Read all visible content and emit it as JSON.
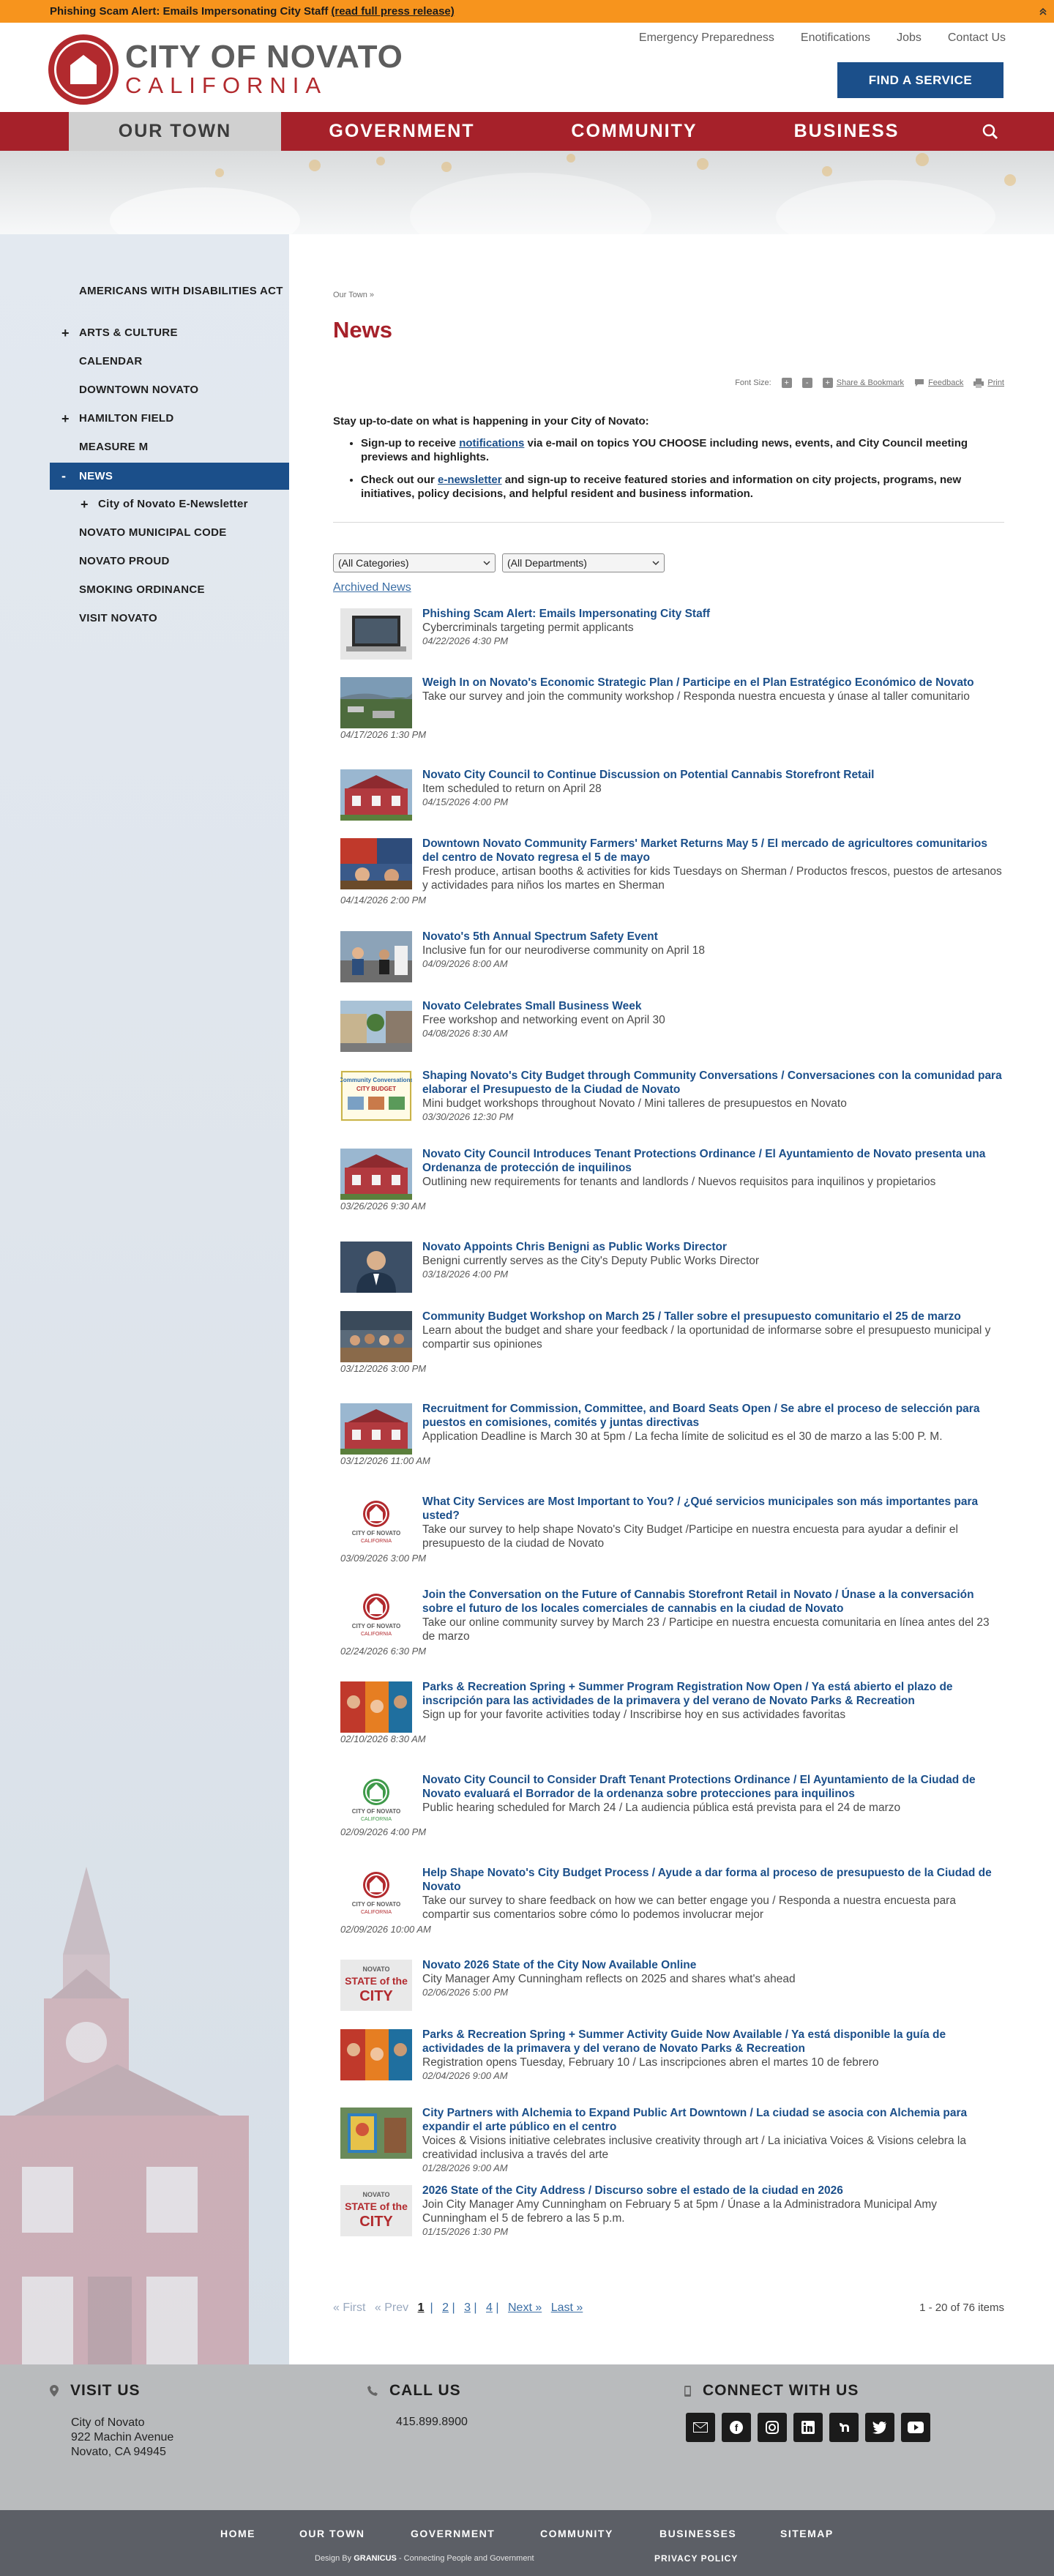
{
  "alert": {
    "text": "Phishing Scam Alert: Emails Impersonating City Staff",
    "link": "(read full press release)"
  },
  "header": {
    "logo_line1": "CITY OF NOVATO",
    "logo_line2": "CALIFORNIA",
    "utility_links": [
      "Emergency Preparedness",
      "Enotifications",
      "Jobs",
      "Contact Us"
    ],
    "find_service": "FIND A SERVICE"
  },
  "nav": {
    "items": [
      "OUR TOWN",
      "GOVERNMENT",
      "COMMUNITY",
      "BUSINESS"
    ],
    "active": "OUR TOWN"
  },
  "sidebar": {
    "items": [
      {
        "label": "AMERICANS WITH DISABILITIES ACT",
        "expand": ""
      },
      {
        "label": "ARTS & CULTURE",
        "expand": "+"
      },
      {
        "label": "CALENDAR",
        "expand": ""
      },
      {
        "label": "DOWNTOWN NOVATO",
        "expand": ""
      },
      {
        "label": "HAMILTON FIELD",
        "expand": "+"
      },
      {
        "label": "MEASURE M",
        "expand": ""
      },
      {
        "label": "NEWS",
        "expand": "-"
      },
      {
        "label": "City of Novato E-Newsletter",
        "expand": "+"
      },
      {
        "label": "NOVATO MUNICIPAL CODE",
        "expand": ""
      },
      {
        "label": "NOVATO PROUD",
        "expand": ""
      },
      {
        "label": "SMOKING ORDINANCE",
        "expand": ""
      },
      {
        "label": "VISIT NOVATO",
        "expand": ""
      }
    ]
  },
  "page": {
    "breadcrumb": "Our Town »",
    "title": "News",
    "tools": {
      "font_size": "Font Size:",
      "font_plus": "+",
      "font_minus": "-",
      "share": "Share & Bookmark",
      "feedback": "Feedback",
      "print": "Print"
    },
    "intro": "Stay up-to-date on what is happening in your City of Novato:",
    "bullet1_pre": "Sign-up to receive ",
    "bullet1_link": "notifications",
    "bullet1_post": " via e-mail on topics YOU CHOOSE including news, events, and City Council meeting previews and highlights.",
    "bullet2_pre": "Check out our ",
    "bullet2_link": "e-newsletter",
    "bullet2_post": " and sign-up to receive featured stories and information on city projects, programs, new initiatives, policy decisions, and helpful resident and business information.",
    "filter_categories": "(All Categories)",
    "filter_departments": "(All Departments)",
    "archived": "Archived News"
  },
  "news": [
    {
      "title": "Phishing Scam Alert: Emails Impersonating City Staff",
      "desc": "Cybercriminals targeting permit applicants",
      "date": "04/22/2026 4:30 PM",
      "thumb": "laptop"
    },
    {
      "title": "Weigh In on Novato's Economic Strategic Plan / Participe en el Plan Estratégico Económico de Novato",
      "desc": "Take our survey and join the community workshop / Responda nuestra encuesta y únase al taller comunitario",
      "date": "04/17/2026 1:30 PM",
      "thumb": "aerial"
    },
    {
      "title": "Novato City Council to Continue Discussion on Potential Cannabis Storefront Retail",
      "desc": "Item scheduled to return on April 28",
      "date": "04/15/2026 4:00 PM",
      "thumb": "cityhall"
    },
    {
      "title": "Downtown Novato Community Farmers' Market Returns May 5 / El mercado de agricultores comunitarios del centro de Novato regresa el 5 de mayo",
      "desc": "Fresh produce, artisan booths & activities for kids Tuesdays on Sherman / Productos frescos, puestos de artesanos y actividades para niños los martes en Sherman",
      "date": "04/14/2026 2:00 PM",
      "thumb": "market"
    },
    {
      "title": "Novato's 5th Annual Spectrum Safety Event",
      "desc": "Inclusive fun for our neurodiverse community on April 18",
      "date": "04/09/2026 8:00 AM",
      "thumb": "event"
    },
    {
      "title": "Novato Celebrates Small Business Week",
      "desc": "Free workshop and networking event on April 30",
      "date": "04/08/2026 8:30 AM",
      "thumb": "street"
    },
    {
      "title": "Shaping Novato's City Budget through Community Conversations / Conversaciones con la comunidad para elaborar el Presupuesto de la Ciudad de Novato",
      "desc": "Mini budget workshops throughout Novato / Mini talleres de presupuestos en Novato",
      "date": "03/30/2026 12:30 PM",
      "thumb": "flyer"
    },
    {
      "title": "Novato City Council Introduces Tenant Protections Ordinance / El Ayuntamiento de Novato presenta una Ordenanza de protección de inquilinos",
      "desc": "Outlining new requirements for tenants and landlords / Nuevos requisitos para inquilinos y propietarios",
      "date": "03/26/2026 9:30 AM",
      "thumb": "cityhall"
    },
    {
      "title": "Novato Appoints Chris Benigni as Public Works Director",
      "desc": "Benigni currently serves as the City's Deputy Public Works Director",
      "date": "03/18/2026 4:00 PM",
      "thumb": "portrait"
    },
    {
      "title": "Community Budget Workshop on March 25 / Taller sobre el presupuesto comunitario el 25 de marzo",
      "desc": "Learn about the budget and share your feedback / la oportunidad de informarse sobre el presupuesto municipal y compartir sus opiniones",
      "date": "03/12/2026 3:00 PM",
      "thumb": "meeting"
    },
    {
      "title": "Recruitment for Commission, Committee, and Board Seats Open / Se abre el proceso de selección para puestos en comisiones, comités y juntas directivas",
      "desc": "Application Deadline is March 30 at 5pm / La fecha límite de solicitud es el 30 de marzo a las 5:00 P. M.",
      "date": "03/12/2026 11:00 AM",
      "thumb": "cityhall"
    },
    {
      "title": "What City Services are Most Important to You? / ¿Qué servicios municipales son más importantes para usted?",
      "desc": "Take our survey to help shape Novato's City Budget /Participe en nuestra encuesta para ayudar a definir el presupuesto de la ciudad de Novato",
      "date": "03/09/2026 3:00 PM",
      "thumb": "logo-red"
    },
    {
      "title": "Join the Conversation on the Future of Cannabis Storefront Retail in Novato / Únase a la conversación sobre el futuro de los locales comerciales de cannabis en la ciudad de Novato",
      "desc": "Take our online community survey by March 23 / Participe en nuestra encuesta comunitaria en línea antes del 23 de marzo",
      "date": "02/24/2026 6:30 PM",
      "thumb": "logo-red"
    },
    {
      "title": "Parks & Recreation Spring + Summer Program Registration Now Open / Ya está abierto el plazo de inscripción para las actividades de la primavera y del verano de Novato Parks & Recreation",
      "desc": "Sign up for your favorite activities today / Inscribirse hoy en sus actividades favoritas",
      "date": "02/10/2026 8:30 AM",
      "thumb": "guide"
    },
    {
      "title": "Novato City Council to Consider Draft Tenant Protections Ordinance / El Ayuntamiento de la Ciudad de Novato evaluará el Borrador de la ordenanza sobre protecciones para inquilinos",
      "desc": "Public hearing scheduled for March 24 / La audiencia pública está prevista para el 24 de marzo",
      "date": "02/09/2026 4:00 PM",
      "thumb": "logo-green"
    },
    {
      "title": "Help Shape Novato's City Budget Process / Ayude a dar forma al proceso de presupuesto de la Ciudad de Novato",
      "desc": "Take our survey to share feedback on how we can better engage you / Responda a nuestra encuesta para compartir sus comentarios sobre cómo lo podemos involucrar mejor",
      "date": "02/09/2026 10:00 AM",
      "thumb": "logo-red"
    },
    {
      "title": "Novato 2026 State of the City Now Available Online",
      "desc": "City Manager Amy Cunningham reflects on 2025 and shares what's ahead",
      "date": "02/06/2026 5:00 PM",
      "thumb": "state"
    },
    {
      "title": "Parks & Recreation Spring + Summer Activity Guide Now Available / Ya está disponible la guía de actividades de la primavera y del verano de Novato Parks & Recreation",
      "desc": "Registration opens Tuesday, February 10 / Las inscripciones abren el martes 10 de febrero",
      "date": "02/04/2026 9:00 AM",
      "thumb": "guide"
    },
    {
      "title": "City Partners with Alchemia to Expand Public Art Downtown / La ciudad se asocia con Alchemia para expandir el arte público en el centro",
      "desc": "Voices & Visions initiative celebrates inclusive creativity through art / La iniciativa Voices & Visions celebra la creatividad inclusiva a través del arte",
      "date": "01/28/2026 9:00 AM",
      "thumb": "mural"
    },
    {
      "title": "2026 State of the City Address / Discurso sobre el estado de la ciudad en 2026",
      "desc": "Join City Manager Amy Cunningham on February 5 at 5pm / Únase a la Administradora Municipal Amy Cunningham el 5 de febrero a las 5 p.m.",
      "date": "01/15/2026 1:30 PM",
      "thumb": "state"
    }
  ],
  "thumb_labels": {
    "logo_city": "CITY OF NOVATO",
    "logo_state": "CALIFORNIA",
    "state_top": "NOVATO",
    "state_mid": "STATE of the",
    "state_bot": "CITY",
    "flyer_head": "Community Conversations",
    "flyer_sub": "CITY BUDGET"
  },
  "pager": {
    "first": "« First",
    "prev": "« Prev",
    "pages": [
      "1",
      "2",
      "3",
      "4"
    ],
    "next": "Next »",
    "last": "Last »",
    "count": "1 - 20 of 76 items"
  },
  "footer": {
    "visit_heading": "VISIT US",
    "address": [
      "City of Novato",
      "922 Machin Avenue",
      "Novato, CA 94945"
    ],
    "call_heading": "CALL US",
    "phone": "415.899.8900",
    "connect_heading": "CONNECT WITH US",
    "social": [
      "email",
      "facebook",
      "instagram",
      "linkedin",
      "nextdoor",
      "twitter",
      "youtube"
    ],
    "bottom_links": [
      "HOME",
      "OUR TOWN",
      "GOVERNMENT",
      "COMMUNITY",
      "BUSINESSES",
      "SITEMAP"
    ],
    "credit_pre": "Design By",
    "credit_brand": "GRANICUS",
    "credit_post": "- Connecting People and Government",
    "policy": "PRIVACY POLICY"
  },
  "colors": {
    "alert": "#f7941d",
    "brand_red": "#a6212a",
    "brand_blue": "#1b4f8a",
    "footer_gray": "#b9bbbd",
    "bottom_bar": "#5c5f66"
  }
}
